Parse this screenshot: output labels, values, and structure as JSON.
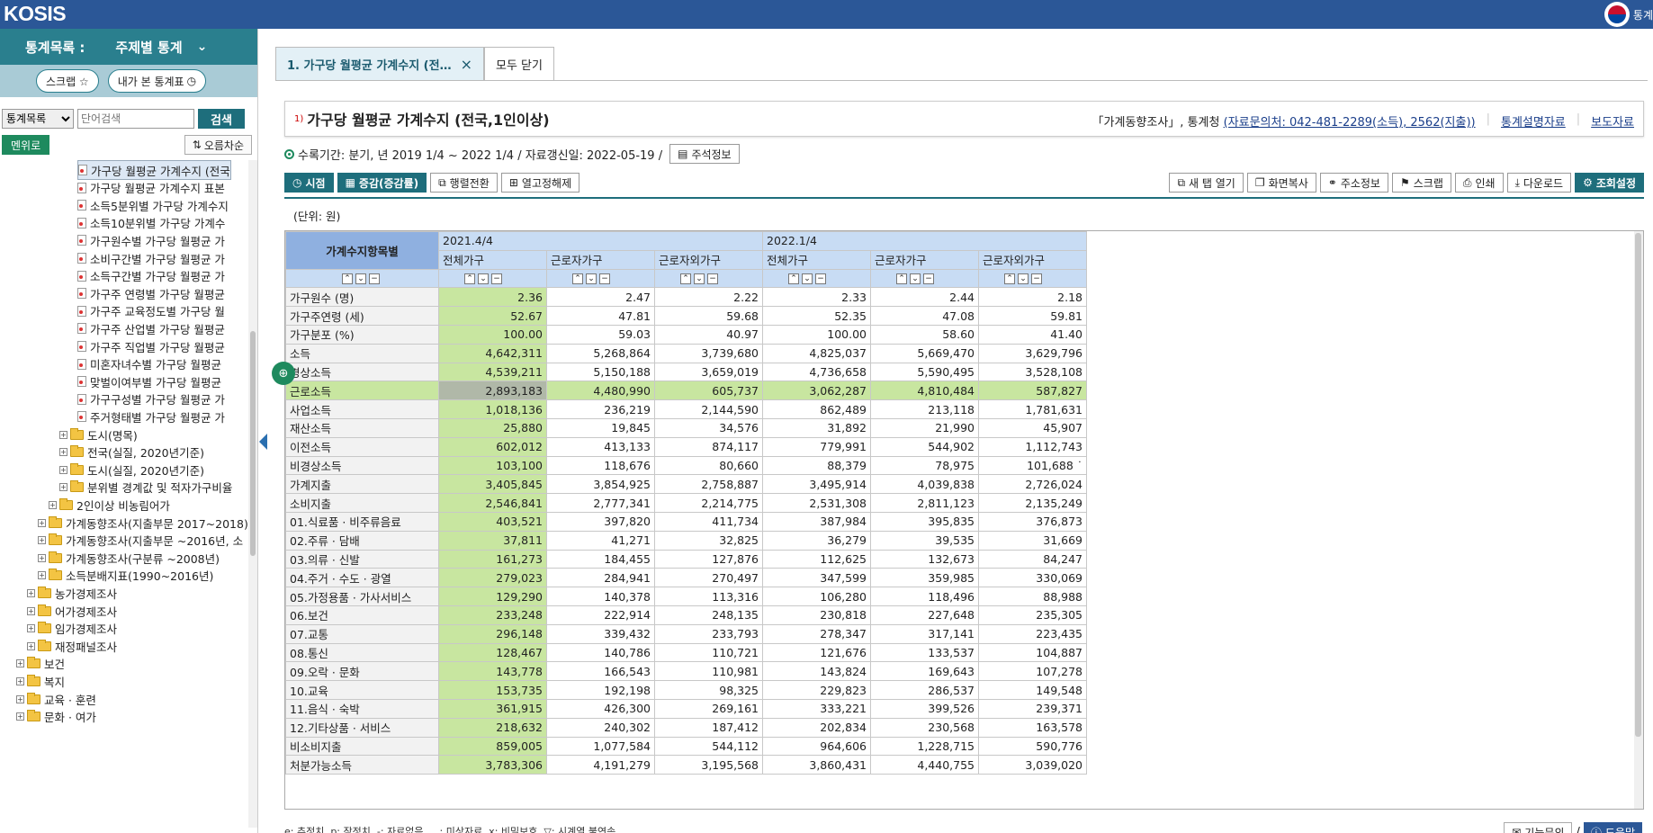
{
  "header": {
    "logo": "KOSIS",
    "right_text": "통계"
  },
  "sidebar": {
    "title": "통계목록 :",
    "category": "주제별 통계",
    "scrap_btn": "스크랩 ☆",
    "mystats_btn": "내가 본 통계표",
    "search_select": "통계목록",
    "search_placeholder": "단어검색",
    "search_btn": "검색",
    "menu_btn": "멘위로",
    "sort_btn": "오름차순",
    "tree": [
      {
        "label": "가구당 월평균 가계수지 (전국",
        "level": 7,
        "type": "doc",
        "selected": true
      },
      {
        "label": "가구당 월평균 가계수지 표본",
        "level": 7,
        "type": "doc"
      },
      {
        "label": "소득5분위별 가구당 가계수지",
        "level": 7,
        "type": "doc"
      },
      {
        "label": "소득10분위별 가구당 가계수",
        "level": 7,
        "type": "doc"
      },
      {
        "label": "가구원수별 가구당 월평균 가",
        "level": 7,
        "type": "doc"
      },
      {
        "label": "소비구간별 가구당 월평균 가",
        "level": 7,
        "type": "doc"
      },
      {
        "label": "소득구간별 가구당 월평균 가",
        "level": 7,
        "type": "doc"
      },
      {
        "label": "가구주 연령별 가구당 월평균",
        "level": 7,
        "type": "doc"
      },
      {
        "label": "가구주 교육정도별 가구당 월",
        "level": 7,
        "type": "doc"
      },
      {
        "label": "가구주 산업별 가구당 월평균",
        "level": 7,
        "type": "doc"
      },
      {
        "label": "가구주 직업별 가구당 월평균",
        "level": 7,
        "type": "doc"
      },
      {
        "label": "미혼자녀수별 가구당 월평균",
        "level": 7,
        "type": "doc"
      },
      {
        "label": "맞벌이여부별 가구당 월평균",
        "level": 7,
        "type": "doc"
      },
      {
        "label": "가구구성별 가구당 월평균 가",
        "level": 7,
        "type": "doc"
      },
      {
        "label": "주거형태별 가구당 월평균 가",
        "level": 7,
        "type": "doc"
      },
      {
        "label": "도시(명목)",
        "level": 5,
        "type": "folder"
      },
      {
        "label": "전국(실질, 2020년기준)",
        "level": 5,
        "type": "folder"
      },
      {
        "label": "도시(실질, 2020년기준)",
        "level": 5,
        "type": "folder"
      },
      {
        "label": "분위별 경계값 및 적자가구비율",
        "level": 5,
        "type": "folder"
      },
      {
        "label": "2인이상 비농림어가",
        "level": 4,
        "type": "folder"
      },
      {
        "label": "가계동향조사(지출부문 2017~2018)",
        "level": 3,
        "type": "folder"
      },
      {
        "label": "가계동향조사(지출부문 ~2016년, 소",
        "level": 3,
        "type": "folder"
      },
      {
        "label": "가계동향조사(구분류 ~2008년)",
        "level": 3,
        "type": "folder"
      },
      {
        "label": "소득분배지표(1990~2016년)",
        "level": 3,
        "type": "folder"
      },
      {
        "label": "농가경제조사",
        "level": 2,
        "type": "folder"
      },
      {
        "label": "어가경제조사",
        "level": 2,
        "type": "folder"
      },
      {
        "label": "임가경제조사",
        "level": 2,
        "type": "folder"
      },
      {
        "label": "재정패널조사",
        "level": 2,
        "type": "folder"
      },
      {
        "label": "보건",
        "level": 1,
        "type": "folder"
      },
      {
        "label": "복지",
        "level": 1,
        "type": "folder"
      },
      {
        "label": "교육 · 훈련",
        "level": 1,
        "type": "folder"
      },
      {
        "label": "문화 · 여가",
        "level": 1,
        "type": "folder"
      }
    ]
  },
  "tabs": {
    "active": "1. 가구당 월평균 가계수지 (전…",
    "close_all": "모두 닫기"
  },
  "title": {
    "sup": "1)",
    "text": "가구당 월평균 가계수지 (전국,1인이상)",
    "source": "「가계동향조사」, 통계청",
    "contact": "(자료문의처: 042-481-2289(소득), 2562(지출))",
    "link1": "통계설명자료",
    "link2": "보도자료"
  },
  "meta": {
    "text": "수록기간: 분기, 년 2019 1/4 ~ 2022 1/4 / 자료갱신일: 2022-05-19 /",
    "note_btn": "주석정보"
  },
  "toolbar": {
    "left": [
      "시점",
      "증감(증감률)",
      "행렬전환",
      "열고정해제"
    ],
    "right": [
      "새 탭 열기",
      "화면복사",
      "주소정보",
      "스크랩",
      "인쇄",
      "다운로드",
      "조회설정"
    ]
  },
  "unit": "(단위: 원)",
  "table": {
    "rowhead": "가계수지항목별",
    "periods": [
      "2021.4/4",
      "2022.1/4"
    ],
    "cols": [
      "전체가구",
      "근로자가구",
      "근로자외가구",
      "전체가구",
      "근로자가구",
      "근로자외가구"
    ],
    "rows": [
      {
        "label": "가구원수 (명)",
        "values": [
          "2.36",
          "2.47",
          "2.22",
          "2.33",
          "2.44",
          "2.18"
        ]
      },
      {
        "label": "가구주연령 (세)",
        "values": [
          "52.67",
          "47.81",
          "59.68",
          "52.35",
          "47.08",
          "59.81"
        ]
      },
      {
        "label": "가구분포 (%)",
        "values": [
          "100.00",
          "59.03",
          "40.97",
          "100.00",
          "58.60",
          "41.40"
        ]
      },
      {
        "label": "소득",
        "values": [
          "4,642,311",
          "5,268,864",
          "3,739,680",
          "4,825,037",
          "5,669,470",
          "3,629,796"
        ]
      },
      {
        "label": "경상소득",
        "values": [
          "4,539,211",
          "5,150,188",
          "3,659,019",
          "4,736,658",
          "5,590,495",
          "3,528,108"
        ]
      },
      {
        "label": "근로소득",
        "values": [
          "2,893,183",
          "4,480,990",
          "605,737",
          "3,062,287",
          "4,810,484",
          "587,827"
        ],
        "selected": true
      },
      {
        "label": "사업소득",
        "values": [
          "1,018,136",
          "236,219",
          "2,144,590",
          "862,489",
          "213,118",
          "1,781,631"
        ]
      },
      {
        "label": "재산소득",
        "values": [
          "25,880",
          "19,845",
          "34,576",
          "31,892",
          "21,990",
          "45,907"
        ]
      },
      {
        "label": "이전소득",
        "values": [
          "602,012",
          "413,133",
          "874,117",
          "779,991",
          "544,902",
          "1,112,743"
        ]
      },
      {
        "label": "비경상소득",
        "values": [
          "103,100",
          "118,676",
          "80,660",
          "88,379",
          "78,975",
          "101,688 ˙"
        ]
      },
      {
        "label": "가계지출",
        "values": [
          "3,405,845",
          "3,854,925",
          "2,758,887",
          "3,495,914",
          "4,039,838",
          "2,726,024"
        ]
      },
      {
        "label": "소비지출",
        "values": [
          "2,546,841",
          "2,777,341",
          "2,214,775",
          "2,531,308",
          "2,811,123",
          "2,135,249"
        ]
      },
      {
        "label": "01.식료품 · 비주류음료",
        "values": [
          "403,521",
          "397,820",
          "411,734",
          "387,984",
          "395,835",
          "376,873"
        ]
      },
      {
        "label": "02.주류 · 담배",
        "values": [
          "37,811",
          "41,271",
          "32,825",
          "36,279",
          "39,535",
          "31,669"
        ]
      },
      {
        "label": "03.의류 · 신발",
        "values": [
          "161,273",
          "184,455",
          "127,876",
          "112,625",
          "132,673",
          "84,247"
        ]
      },
      {
        "label": "04.주거 · 수도 · 광열",
        "values": [
          "279,023",
          "284,941",
          "270,497",
          "347,599",
          "359,985",
          "330,069"
        ]
      },
      {
        "label": "05.가정용품 · 가사서비스",
        "values": [
          "129,290",
          "140,378",
          "113,316",
          "106,280",
          "118,496",
          "88,988"
        ]
      },
      {
        "label": "06.보건",
        "values": [
          "233,248",
          "222,914",
          "248,135",
          "230,818",
          "227,648",
          "235,305"
        ]
      },
      {
        "label": "07.교통",
        "values": [
          "296,148",
          "339,432",
          "233,793",
          "278,347",
          "317,141",
          "223,435"
        ]
      },
      {
        "label": "08.통신",
        "values": [
          "128,467",
          "140,786",
          "110,721",
          "121,676",
          "133,537",
          "104,887"
        ]
      },
      {
        "label": "09.오락 · 문화",
        "values": [
          "143,778",
          "166,543",
          "110,981",
          "143,824",
          "169,643",
          "107,278"
        ]
      },
      {
        "label": "10.교육",
        "values": [
          "153,735",
          "192,198",
          "98,325",
          "229,823",
          "286,537",
          "149,548"
        ]
      },
      {
        "label": "11.음식 · 숙박",
        "values": [
          "361,915",
          "426,300",
          "269,161",
          "333,221",
          "399,526",
          "239,371"
        ]
      },
      {
        "label": "12.기타상품 · 서비스",
        "values": [
          "218,632",
          "240,302",
          "187,412",
          "202,834",
          "230,568",
          "163,578"
        ]
      },
      {
        "label": "비소비지출",
        "values": [
          "859,005",
          "1,077,584",
          "544,112",
          "964,606",
          "1,228,715",
          "590,776"
        ]
      },
      {
        "label": "처분가능소득",
        "values": [
          "3,783,306",
          "4,191,279",
          "3,195,568",
          "3,860,431",
          "4,440,755",
          "3,039,020"
        ]
      }
    ]
  },
  "legend": "e: 추정치, p: 잠정치, -: 자료없음, …: 미상자료, x: 비밀보호, ▽: 시계열 불연속",
  "bottom": {
    "inquiry": "기능문의",
    "help": "도움말"
  }
}
